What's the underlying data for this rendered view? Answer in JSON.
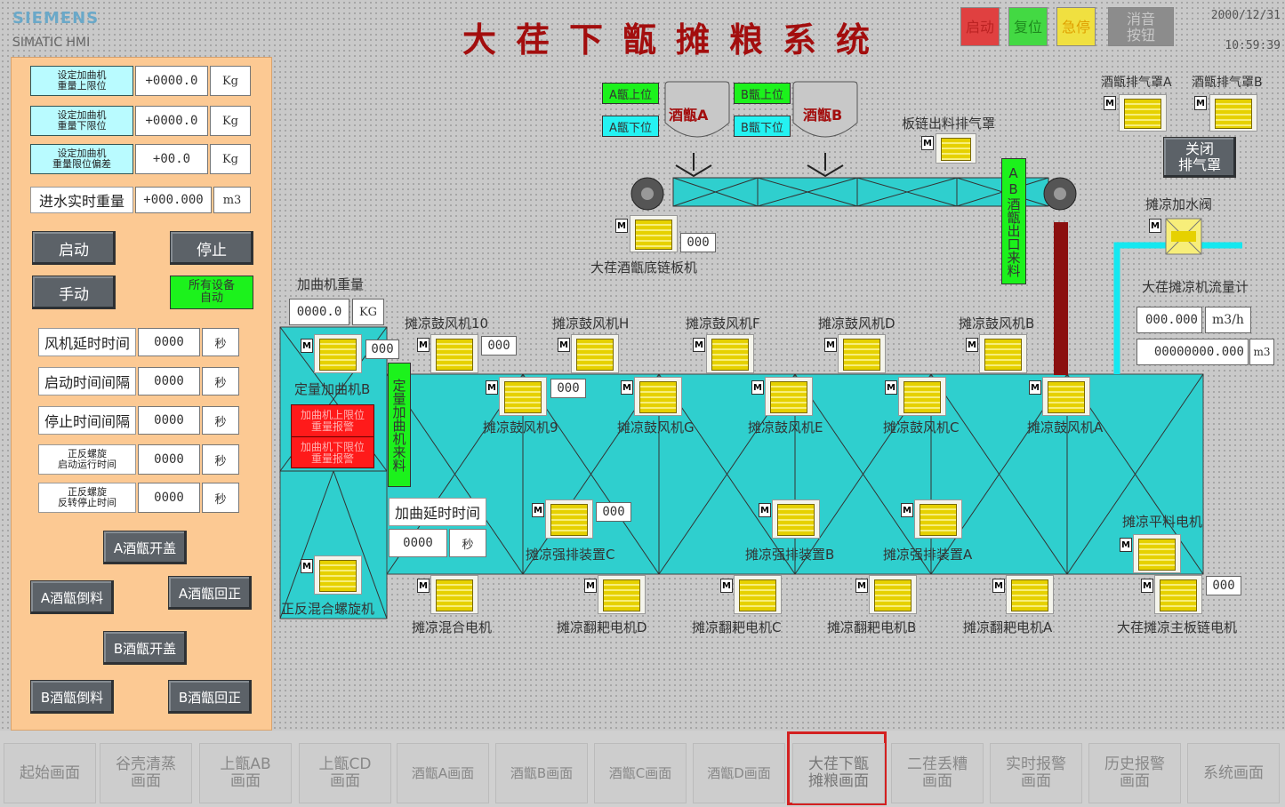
{
  "brand": {
    "name": "SIEMENS",
    "product": "SIMATIC HMI"
  },
  "title": "大荏下甑摊粮系统",
  "top_buttons": [
    {
      "label": "启动",
      "color": "#e04040"
    },
    {
      "label": "复位",
      "color": "#43d943"
    },
    {
      "label": "急停",
      "color": "#f0e040"
    },
    {
      "label": "消音\n按钮",
      "color": "#8c8c8c"
    }
  ],
  "datetime": {
    "date": "2000/12/31",
    "time": "10:59:39"
  },
  "left_panel": {
    "weight_settings": [
      {
        "label": "设定加曲机\n重量上限位",
        "value": "+0000.0",
        "unit": "Kg"
      },
      {
        "label": "设定加曲机\n重量下限位",
        "value": "+0000.0",
        "unit": "Kg"
      },
      {
        "label": "设定加曲机\n重量限位偏差",
        "value": "+00.0",
        "unit": "Kg"
      }
    ],
    "water_weight": {
      "label": "进水实时重量",
      "value": "+000.000",
      "unit": "m3"
    },
    "start_btn": "启动",
    "stop_btn": "停止",
    "manual_btn": "手动",
    "auto_btn": "所有设备\n自动",
    "timers": [
      {
        "label": "风机延时时间",
        "value": "0000",
        "unit": "秒"
      },
      {
        "label": "启动时间间隔",
        "value": "0000",
        "unit": "秒"
      },
      {
        "label": "停止时间间隔",
        "value": "0000",
        "unit": "秒"
      },
      {
        "label": "正反螺旋\n启动运行时间",
        "value": "0000",
        "unit": "秒"
      },
      {
        "label": "正反螺旋\n反转停止时间",
        "value": "0000",
        "unit": "秒"
      }
    ],
    "a_open": "A酒甑开盖",
    "a_dump": "A酒甑倒料",
    "a_return": "A酒甑回正",
    "b_open": "B酒甑开盖",
    "b_dump": "B酒甑倒料",
    "b_return": "B酒甑回正"
  },
  "process": {
    "steamer_a": "酒甑A",
    "steamer_b": "酒甑B",
    "a_up": "A甑上位",
    "a_down": "A甑下位",
    "b_up": "B甑上位",
    "b_down": "B甑下位",
    "chain_exhaust": "板链出料排气罩",
    "exhaust_a": "酒甑排气罩A",
    "exhaust_b": "酒甑排气罩B",
    "close_exhaust": "关闭\n排气罩",
    "ab_feed": "AB酒甑出口来料",
    "water_valve": "摊凉加水阀",
    "flowmeter": "大荏摊凉机流量计",
    "flow_rate": "000.000",
    "flow_rate_unit": "m3/h",
    "flow_total": "00000000.000",
    "flow_total_unit": "m3",
    "bottom_chain": "大荏酒甑底链板机",
    "bottom_chain_val": "000",
    "mixer_weight_label": "加曲机重量",
    "mixer_weight_val": "0000.0",
    "mixer_weight_unit": "KG",
    "dosing_mixer": "定量加曲机B",
    "dosing_val": "000",
    "alarm_upper": "加曲机上限位\n重量报警",
    "alarm_lower": "加曲机下限位\n重量报警",
    "feed_label": "定量加曲机来料",
    "screw": "正反混合螺旋机",
    "delay_label": "加曲延时时间",
    "delay_val": "0000",
    "delay_unit": "秒",
    "fans_top": [
      {
        "name": "摊凉鼓风机10",
        "val": "000"
      },
      {
        "name": "摊凉鼓风机H"
      },
      {
        "name": "摊凉鼓风机F"
      },
      {
        "name": "摊凉鼓风机D"
      },
      {
        "name": "摊凉鼓风机B"
      }
    ],
    "fans_mid": [
      {
        "name": "摊凉鼓风机9",
        "val": "000"
      },
      {
        "name": "摊凉鼓风机G"
      },
      {
        "name": "摊凉鼓风机E"
      },
      {
        "name": "摊凉鼓风机C"
      },
      {
        "name": "摊凉鼓风机A"
      }
    ],
    "exhausters": [
      {
        "name": "摊凉强排装置C",
        "val": "000"
      },
      {
        "name": "摊凉强排装置B"
      },
      {
        "name": "摊凉强排装置A"
      }
    ],
    "leveler": "摊凉平料电机",
    "bottom_motors": [
      {
        "name": "摊凉混合电机"
      },
      {
        "name": "摊凉翻耙电机D"
      },
      {
        "name": "摊凉翻耙电机C"
      },
      {
        "name": "摊凉翻耙电机B"
      },
      {
        "name": "摊凉翻耙电机A"
      },
      {
        "name": "大荏摊凉主板链电机",
        "val": "000"
      }
    ],
    "m_tag": "M"
  },
  "nav": [
    {
      "label": "起始画面"
    },
    {
      "label": "谷壳清蒸\n画面"
    },
    {
      "label": "上甑AB\n画面"
    },
    {
      "label": "上甑CD\n画面"
    },
    {
      "label": "酒甑A画面"
    },
    {
      "label": "酒甑B画面"
    },
    {
      "label": "酒甑C画面"
    },
    {
      "label": "酒甑D画面"
    },
    {
      "label": "大荏下甑\n摊粮画面"
    },
    {
      "label": "二荏丢糟\n画面"
    },
    {
      "label": "实时报警\n画面"
    },
    {
      "label": "历史报警\n画面"
    },
    {
      "label": "系统画面"
    }
  ],
  "colors": {
    "panel": "#fcc993",
    "floor": "#2fcfce",
    "alarm": "#ff1a1a",
    "title": "#a30e0e",
    "active_nav": "#d32020"
  }
}
